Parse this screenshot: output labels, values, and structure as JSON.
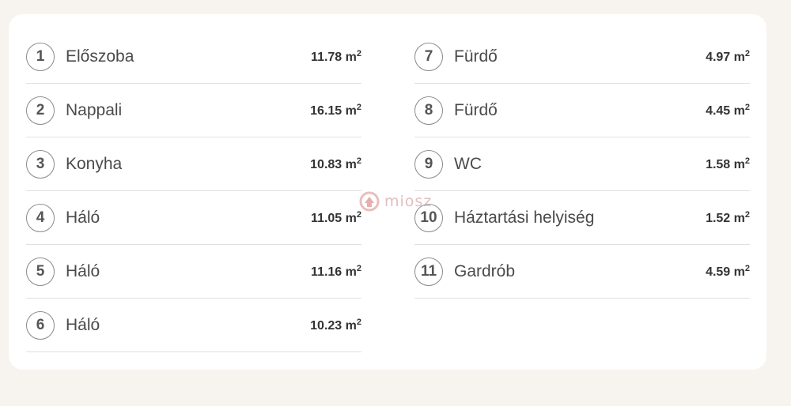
{
  "unit_exponent": "2",
  "left_column": [
    {
      "number": "1",
      "room": "Előszoba",
      "area": "11.78 m"
    },
    {
      "number": "2",
      "room": "Nappali",
      "area": "16.15 m"
    },
    {
      "number": "3",
      "room": "Konyha",
      "area": "10.83 m"
    },
    {
      "number": "4",
      "room": "Háló",
      "area": "11.05 m"
    },
    {
      "number": "5",
      "room": "Háló",
      "area": "11.16 m"
    },
    {
      "number": "6",
      "room": "Háló",
      "area": "10.23 m"
    }
  ],
  "right_column": [
    {
      "number": "7",
      "room": "Fürdő",
      "area": "4.97 m"
    },
    {
      "number": "8",
      "room": "Fürdő",
      "area": "4.45 m"
    },
    {
      "number": "9",
      "room": "WC",
      "area": "1.58 m"
    },
    {
      "number": "10",
      "room": "Háztartási helyiség",
      "area": "1.52 m"
    },
    {
      "number": "11",
      "room": "Gardrób",
      "area": "4.59 m"
    }
  ],
  "watermark": {
    "text": "miosz",
    "icon": "miosz-logo-icon"
  }
}
